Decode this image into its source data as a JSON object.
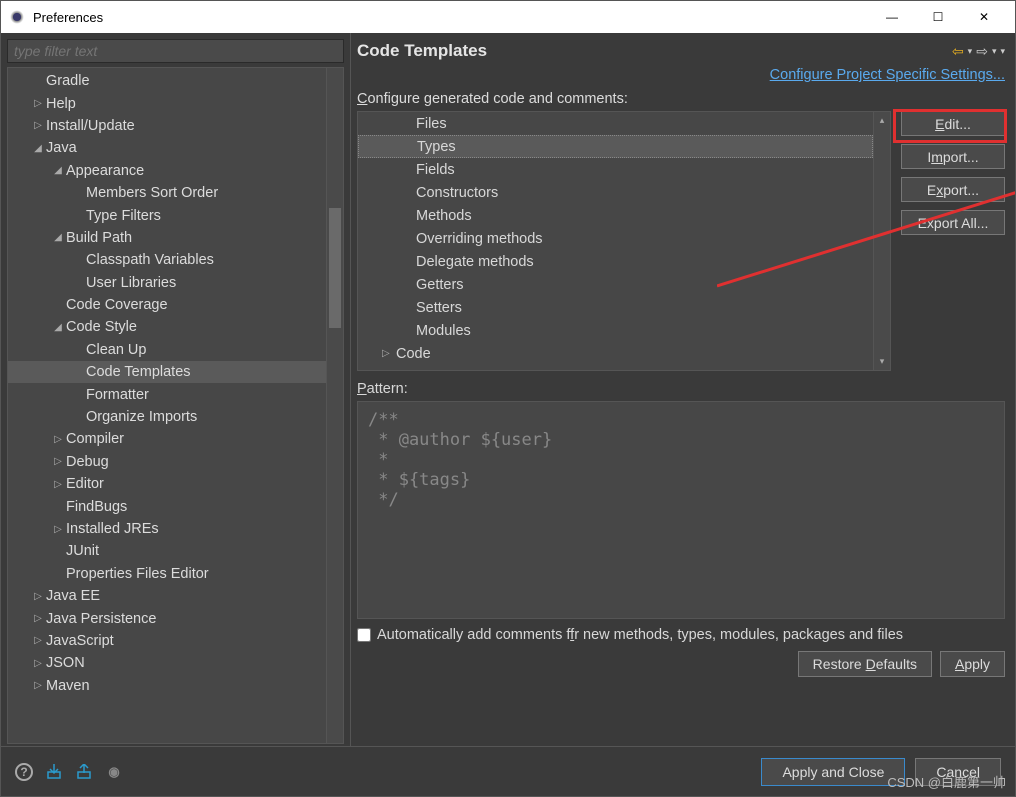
{
  "window": {
    "title": "Preferences"
  },
  "filter": {
    "placeholder": "type filter text"
  },
  "tree": [
    {
      "label": "Gradle",
      "indent": 1,
      "arrow": ""
    },
    {
      "label": "Help",
      "indent": 1,
      "arrow": "▷"
    },
    {
      "label": "Install/Update",
      "indent": 1,
      "arrow": "▷"
    },
    {
      "label": "Java",
      "indent": 1,
      "arrow": "◢"
    },
    {
      "label": "Appearance",
      "indent": 2,
      "arrow": "◢"
    },
    {
      "label": "Members Sort Order",
      "indent": 3,
      "arrow": ""
    },
    {
      "label": "Type Filters",
      "indent": 3,
      "arrow": ""
    },
    {
      "label": "Build Path",
      "indent": 2,
      "arrow": "◢"
    },
    {
      "label": "Classpath Variables",
      "indent": 3,
      "arrow": ""
    },
    {
      "label": "User Libraries",
      "indent": 3,
      "arrow": ""
    },
    {
      "label": "Code Coverage",
      "indent": 2,
      "arrow": ""
    },
    {
      "label": "Code Style",
      "indent": 2,
      "arrow": "◢"
    },
    {
      "label": "Clean Up",
      "indent": 3,
      "arrow": ""
    },
    {
      "label": "Code Templates",
      "indent": 3,
      "arrow": "",
      "selected": true
    },
    {
      "label": "Formatter",
      "indent": 3,
      "arrow": ""
    },
    {
      "label": "Organize Imports",
      "indent": 3,
      "arrow": ""
    },
    {
      "label": "Compiler",
      "indent": 2,
      "arrow": "▷"
    },
    {
      "label": "Debug",
      "indent": 2,
      "arrow": "▷"
    },
    {
      "label": "Editor",
      "indent": 2,
      "arrow": "▷"
    },
    {
      "label": "FindBugs",
      "indent": 2,
      "arrow": ""
    },
    {
      "label": "Installed JREs",
      "indent": 2,
      "arrow": "▷"
    },
    {
      "label": "JUnit",
      "indent": 2,
      "arrow": ""
    },
    {
      "label": "Properties Files Editor",
      "indent": 2,
      "arrow": ""
    },
    {
      "label": "Java EE",
      "indent": 1,
      "arrow": "▷"
    },
    {
      "label": "Java Persistence",
      "indent": 1,
      "arrow": "▷"
    },
    {
      "label": "JavaScript",
      "indent": 1,
      "arrow": "▷"
    },
    {
      "label": "JSON",
      "indent": 1,
      "arrow": "▷"
    },
    {
      "label": "Maven",
      "indent": 1,
      "arrow": "▷"
    }
  ],
  "main": {
    "title": "Code Templates",
    "link": "Configure Project Specific Settings...",
    "configLabel": "Configure generated code and comments:",
    "patternLabel": "Pattern:",
    "checkbox": "Automatically add comments for new methods, types, modules, packages and files"
  },
  "templates": [
    {
      "label": "Files",
      "indent": 2,
      "arrow": ""
    },
    {
      "label": "Types",
      "indent": 2,
      "arrow": "",
      "selected": true
    },
    {
      "label": "Fields",
      "indent": 2,
      "arrow": ""
    },
    {
      "label": "Constructors",
      "indent": 2,
      "arrow": ""
    },
    {
      "label": "Methods",
      "indent": 2,
      "arrow": ""
    },
    {
      "label": "Overriding methods",
      "indent": 2,
      "arrow": ""
    },
    {
      "label": "Delegate methods",
      "indent": 2,
      "arrow": ""
    },
    {
      "label": "Getters",
      "indent": 2,
      "arrow": ""
    },
    {
      "label": "Setters",
      "indent": 2,
      "arrow": ""
    },
    {
      "label": "Modules",
      "indent": 2,
      "arrow": ""
    },
    {
      "label": "Code",
      "indent": 1,
      "arrow": "▷"
    }
  ],
  "buttons": {
    "edit": "Edit...",
    "import": "Import...",
    "export": "Export...",
    "exportAll": "Export All...",
    "restore": "Restore Defaults",
    "apply": "Apply",
    "applyClose": "Apply and Close",
    "cancel": "Cancel"
  },
  "pattern": "/**\n * @author ${user}\n *\n * ${tags}\n */",
  "watermark": "CSDN @白鹿第一帅"
}
